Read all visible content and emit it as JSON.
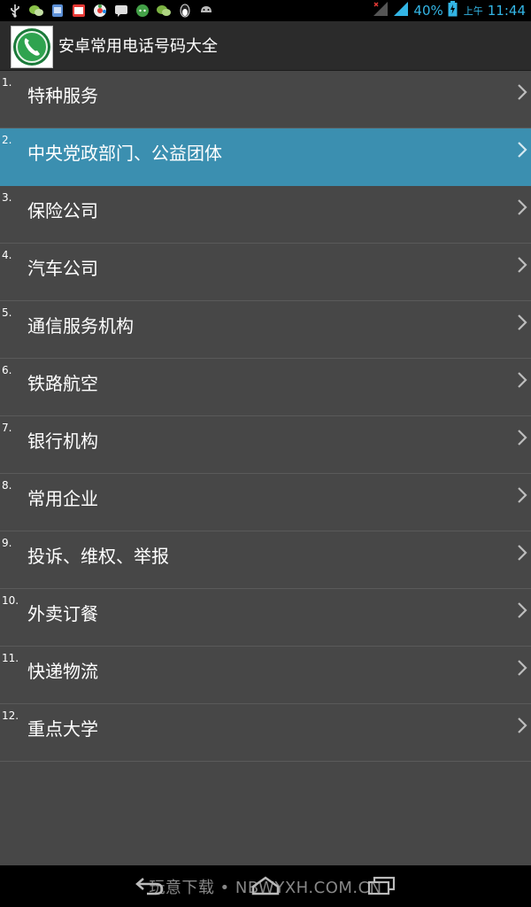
{
  "status_bar": {
    "left_icons": [
      "usb-icon",
      "wechat-icon",
      "sim-icon",
      "photo-icon",
      "wheel-icon",
      "message-icon",
      "chat-icon",
      "wechat2-icon",
      "penguin-icon",
      "android-icon"
    ],
    "battery_percent": "40%",
    "ampm": "上午",
    "time": "11:44",
    "accent_color": "#33b5e5"
  },
  "header": {
    "title": "安卓常用电话号码大全",
    "icon": "phone-icon"
  },
  "list": {
    "items": [
      {
        "number": "1.",
        "label": "特种服务"
      },
      {
        "number": "2.",
        "label": "中央党政部门、公益团体"
      },
      {
        "number": "3.",
        "label": "保险公司"
      },
      {
        "number": "4.",
        "label": "汽车公司"
      },
      {
        "number": "5.",
        "label": "通信服务机构"
      },
      {
        "number": "6.",
        "label": "铁路航空"
      },
      {
        "number": "7.",
        "label": "银行机构"
      },
      {
        "number": "8.",
        "label": "常用企业"
      },
      {
        "number": "9.",
        "label": "投诉、维权、举报"
      },
      {
        "number": "10.",
        "label": "外卖订餐"
      },
      {
        "number": "11.",
        "label": "快递物流"
      },
      {
        "number": "12.",
        "label": "重点大学"
      }
    ],
    "selected_index": 1,
    "selected_color": "#3b8fb0"
  },
  "nav": {
    "watermark": "玩意下载 • NBWYXH.COM.CN",
    "icons": [
      "back-icon",
      "home-icon",
      "recent-apps-icon"
    ]
  }
}
